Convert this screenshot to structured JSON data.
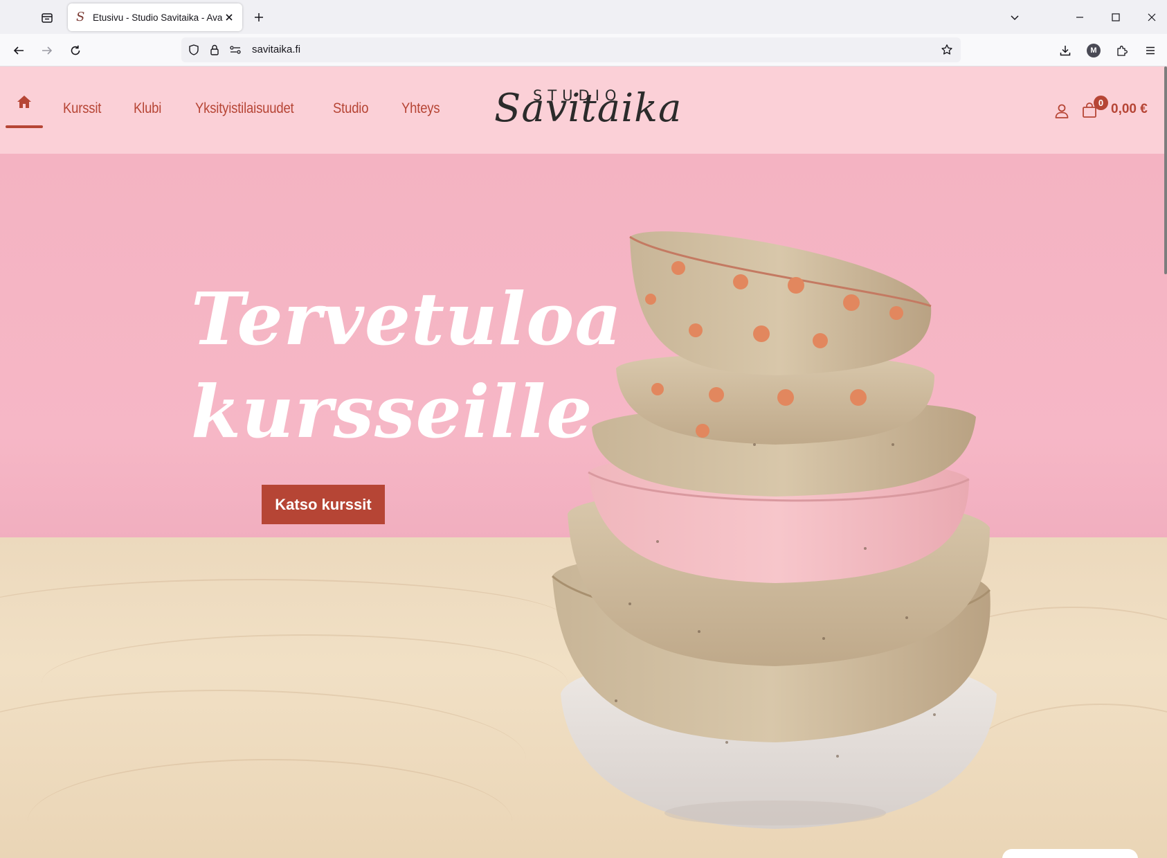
{
  "browser": {
    "tab_title": "Etusivu - Studio Savitaika - Avar",
    "tab_favicon": "S",
    "url": "savitaika.fi",
    "icons": [
      "tab-list-icon",
      "close-icon",
      "plus-icon",
      "chevron-down-icon",
      "minimize-icon",
      "maximize-icon",
      "window-close-icon",
      "back-icon",
      "forward-icon",
      "reload-icon",
      "shield-icon",
      "lock-icon",
      "permissions-icon",
      "bookmark-star-icon",
      "download-icon",
      "account-avatar-icon",
      "extensions-icon",
      "menu-icon"
    ],
    "profile_initial": "M"
  },
  "site": {
    "nav": {
      "home_icon": "home-icon",
      "items": [
        "Kurssit",
        "Klubi",
        "Yksityistilaisuudet",
        "Studio",
        "Yhteys"
      ]
    },
    "logo": {
      "top": "STUDIO",
      "script": "Savitaika"
    },
    "cart": {
      "count": "0",
      "total": "0,00 €"
    },
    "hero": {
      "title_line1": "Tervetuloa",
      "title_line2": "kursseille",
      "cta": "Katso kurssit"
    }
  },
  "colors": {
    "header_bg": "#fbd0d7",
    "accent": "#b64535",
    "hero_wall": "#f4b3c2",
    "table": "#ecd9bd"
  }
}
